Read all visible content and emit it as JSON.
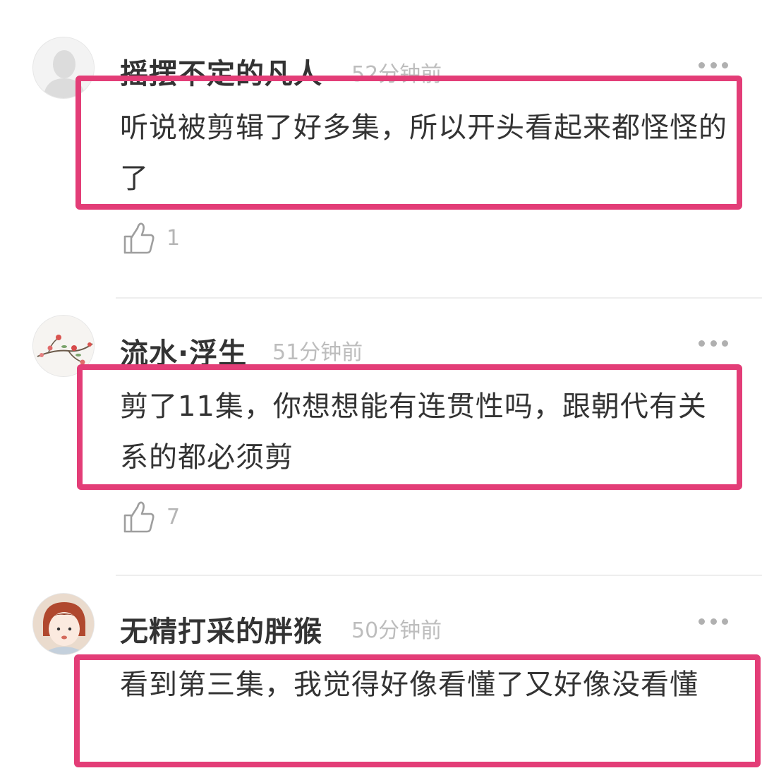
{
  "comments": [
    {
      "user": "摇摆不定的凡人",
      "time": "52分钟前",
      "text": "听说被剪辑了好多集，所以开头看起来都怪怪的了",
      "likes": "1",
      "avatar_icon": "default-user-silhouette-icon"
    },
    {
      "user": "流水·浮生",
      "time": "51分钟前",
      "text": "剪了11集，你想想能有连贯性吗，跟朝代有关系的都必须剪",
      "likes": "7",
      "avatar_icon": "plum-blossom-branch-icon"
    },
    {
      "user": "无精打采的胖猴",
      "time": "50分钟前",
      "text": "看到第三集，我觉得好像看懂了又好像没看懂",
      "likes": "",
      "avatar_icon": "cartoon-girl-icon"
    }
  ],
  "colors": {
    "highlight": "#e33d77",
    "username": "#333333",
    "timestamp": "#bdbdbd",
    "body_text": "#333333",
    "like": "#b5b5b5"
  },
  "icons": {
    "more": "more-dots-icon",
    "like": "thumbs-up-icon"
  }
}
